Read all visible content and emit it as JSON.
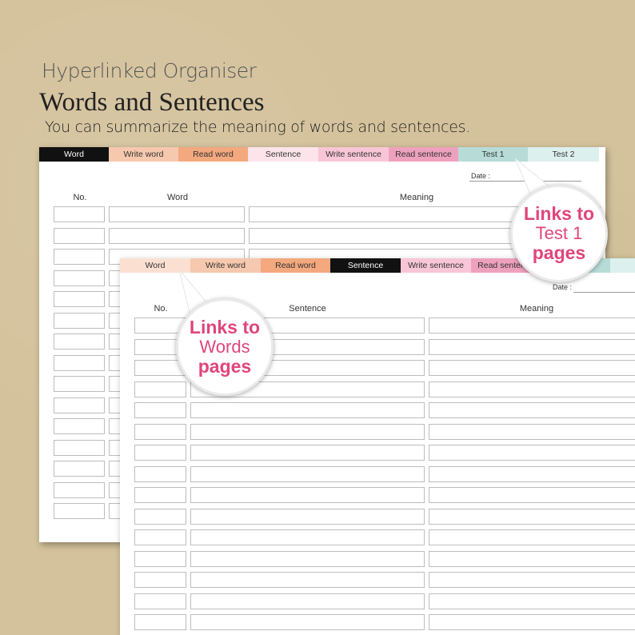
{
  "header": {
    "supertitle": "Hyperlinked Organiser",
    "title": "Words and Sentences",
    "subtitle": "You can summarize the meaning of words and sentences."
  },
  "page_word": {
    "tabs": [
      {
        "label": "Word",
        "bg": "#111111",
        "fg": "#ffffff"
      },
      {
        "label": "Write word",
        "bg": "#f6c8ad",
        "fg": "#333333"
      },
      {
        "label": "Read word",
        "bg": "#f3a87e",
        "fg": "#333333"
      },
      {
        "label": "Sentence",
        "bg": "#fde4ea",
        "fg": "#333333"
      },
      {
        "label": "Write sentence",
        "bg": "#f8c6d6",
        "fg": "#333333"
      },
      {
        "label": "Read sentence",
        "bg": "#eea1bd",
        "fg": "#333333"
      },
      {
        "label": "Test 1",
        "bg": "#b7dcd8",
        "fg": "#333333"
      },
      {
        "label": "Test 2",
        "bg": "#dcf0ee",
        "fg": "#333333"
      }
    ],
    "date_label": "Date :",
    "columns": {
      "no": "No.",
      "word": "Word",
      "meaning": "Meaning"
    }
  },
  "page_sentence": {
    "tabs": [
      {
        "label": "Word",
        "bg": "#fbe0d2",
        "fg": "#333333"
      },
      {
        "label": "Write word",
        "bg": "#f6c8ad",
        "fg": "#333333"
      },
      {
        "label": "Read word",
        "bg": "#f3a87e",
        "fg": "#333333"
      },
      {
        "label": "Sentence",
        "bg": "#111111",
        "fg": "#ffffff"
      },
      {
        "label": "Write sentence",
        "bg": "#f8c6d6",
        "fg": "#333333"
      },
      {
        "label": "Read sentence",
        "bg": "#eea1bd",
        "fg": "#333333"
      },
      {
        "label": "",
        "bg": "#b7dcd8",
        "fg": "#333333"
      },
      {
        "label": "",
        "bg": "#dcf0ee",
        "fg": "#333333"
      }
    ],
    "date_label": "Date :",
    "columns": {
      "no": "No.",
      "sentence": "Sentence",
      "meaning": "Meaning"
    }
  },
  "callouts": {
    "test1": {
      "line1": "Links to",
      "line2": "Test 1",
      "line3": "pages"
    },
    "words": {
      "line1": "Links to",
      "line2": "Words",
      "line3": "pages"
    }
  },
  "colors": {
    "accent": "#e0457b",
    "background": "#d4c29c"
  }
}
